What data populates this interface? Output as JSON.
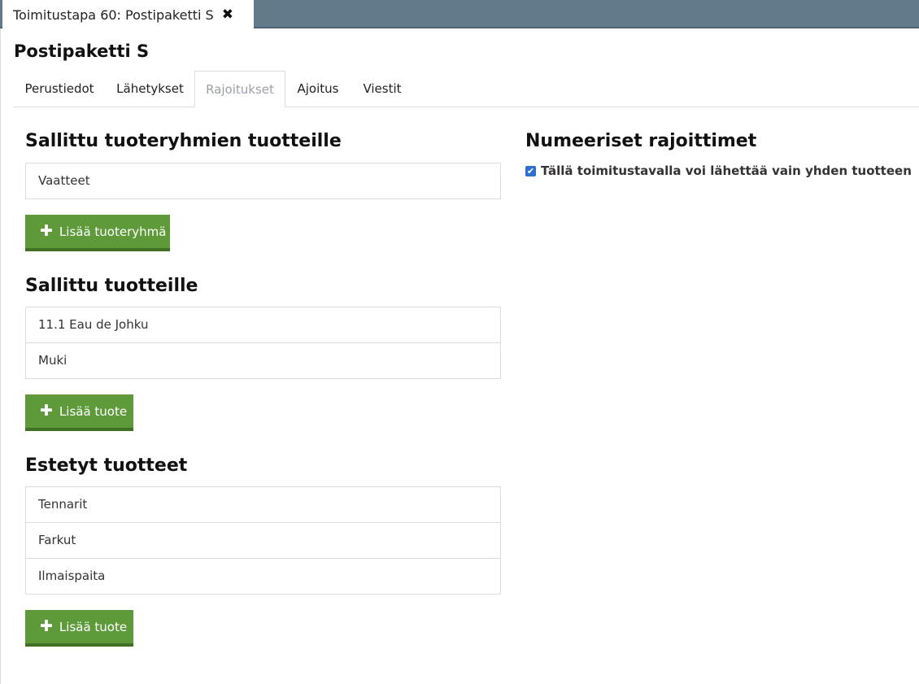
{
  "window": {
    "tab_title": "Toimitustapa 60: Postipaketti S",
    "close_glyph": "✖"
  },
  "page": {
    "title": "Postipaketti S"
  },
  "tabs": [
    {
      "label": "Perustiedot",
      "active": false
    },
    {
      "label": "Lähetykset",
      "active": false
    },
    {
      "label": "Rajoitukset",
      "active": true
    },
    {
      "label": "Ajoitus",
      "active": false
    },
    {
      "label": "Viestit",
      "active": false
    }
  ],
  "allowed_groups": {
    "heading": "Sallittu tuoteryhmien tuotteille",
    "items": [
      "Vaatteet"
    ],
    "button_label": "Lisää tuoteryhmä"
  },
  "allowed_products": {
    "heading": "Sallittu tuotteille",
    "items": [
      "11.1 Eau de Johku",
      "Muki"
    ],
    "button_label": "Lisää tuote"
  },
  "blocked_products": {
    "heading": "Estetyt tuotteet",
    "items": [
      "Tennarit",
      "Farkut",
      "Ilmaispaita"
    ],
    "button_label": "Lisää tuote"
  },
  "numeric_limits": {
    "heading": "Numeeriset rajoittimet",
    "checkbox_label": "Tällä toimitustavalla voi lähettää vain yhden tuotteen",
    "checked": true
  },
  "icons": {
    "plus": "plus-icon",
    "close": "close-icon",
    "check": "checkmark-icon"
  },
  "colors": {
    "topbar": "#637a8a",
    "button": "#5f9a3a",
    "button_border": "#3f7023",
    "checkbox": "#2f6fd0"
  }
}
